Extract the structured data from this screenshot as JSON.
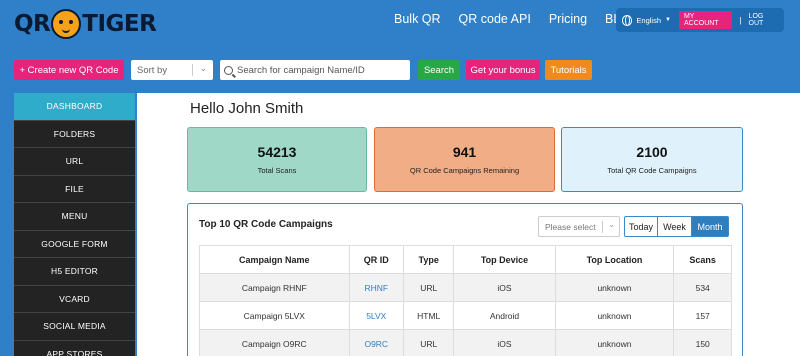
{
  "logo": {
    "left": "QR",
    "right": "TIGER"
  },
  "nav": {
    "items": [
      "Bulk QR",
      "QR code API",
      "Pricing",
      "BLOG"
    ]
  },
  "account": {
    "language": "English",
    "my_account": "MY ACCOUNT",
    "separator": "|",
    "logout": "LOG OUT"
  },
  "toolbar": {
    "create_label": "+ Create new QR Code",
    "sort_placeholder": "Sort by",
    "search_placeholder": "Search for campaign Name/ID",
    "search_label": "Search",
    "bonus_label": "Get your bonus",
    "tutorials_label": "Tutorials"
  },
  "sidebar": {
    "items": [
      {
        "label": "DASHBOARD",
        "active": true
      },
      {
        "label": "FOLDERS"
      },
      {
        "label": "URL"
      },
      {
        "label": "FILE"
      },
      {
        "label": "MENU"
      },
      {
        "label": "GOOGLE FORM"
      },
      {
        "label": "H5 EDITOR"
      },
      {
        "label": "VCARD"
      },
      {
        "label": "SOCIAL MEDIA"
      },
      {
        "label": "APP STORES"
      }
    ]
  },
  "main": {
    "greeting": "Hello John Smith",
    "cards": [
      {
        "value": "54213",
        "label": "Total Scans",
        "color": "#9fd8c6"
      },
      {
        "value": "941",
        "label": "QR Code Campaigns Remaining",
        "color": "#f1ad85"
      },
      {
        "value": "2100",
        "label": "Total QR Code Campaigns",
        "color": "#dff1fb"
      }
    ],
    "campaigns": {
      "title": "Top 10 QR Code Campaigns",
      "select_placeholder": "Please select",
      "periods": [
        "Today",
        "Week",
        "Month"
      ],
      "active_period": "Month",
      "columns": [
        "Campaign Name",
        "QR ID",
        "Type",
        "Top Device",
        "Top Location",
        "Scans"
      ],
      "rows": [
        [
          "Campaign RHNF",
          "RHNF",
          "URL",
          "iOS",
          "unknown",
          "534"
        ],
        [
          "Campaign 5LVX",
          "5LVX",
          "HTML",
          "Android",
          "unknown",
          "157"
        ],
        [
          "Campaign O9RC",
          "O9RC",
          "URL",
          "iOS",
          "unknown",
          "150"
        ]
      ]
    }
  },
  "colors": {
    "header_bg": "#2f80c8",
    "accent_pink": "#e6247c",
    "search_green": "#27a745",
    "tutorial_orange": "#f08a1c",
    "sidebar_active": "#2eacc9",
    "link_blue": "#2f7fbf"
  }
}
